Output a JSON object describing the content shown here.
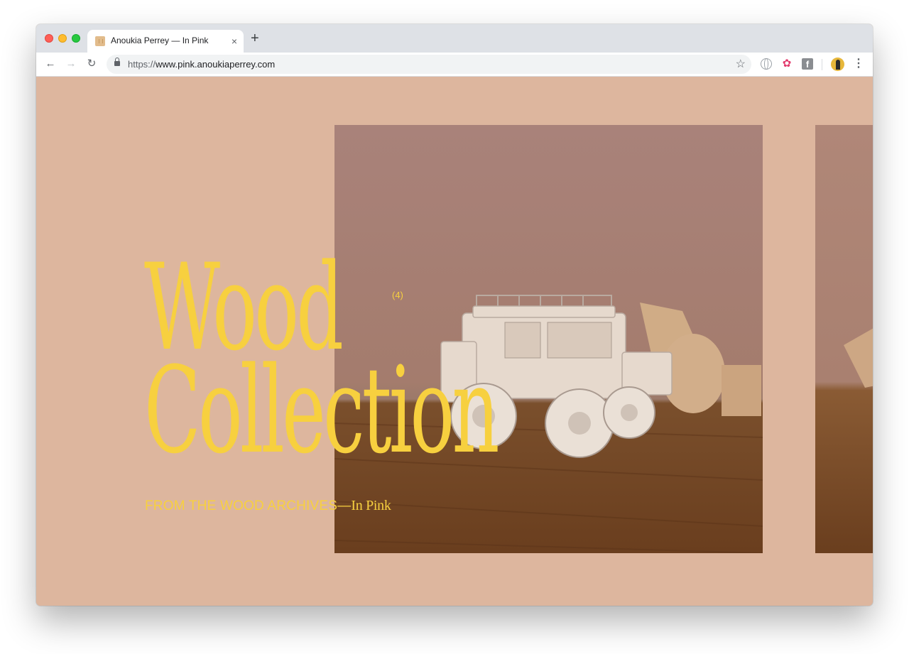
{
  "browser": {
    "tab_title": "Anoukia Perrey — In Pink",
    "tab_close": "×",
    "new_tab": "+",
    "url_scheme": "https://",
    "url_host": "www.pink.anoukiaperrey.com",
    "nav": {
      "back": "←",
      "forward": "→",
      "reload": "↻"
    },
    "bookmark_star": "☆",
    "menu": "⋮",
    "extensions": {
      "facebook": "f",
      "colorful": "✿"
    }
  },
  "page": {
    "heading_line1": "Wood",
    "heading_line2": "Collection",
    "count": "(4)",
    "subtitle_main": "FROM THE WOOD ARCHIVES—",
    "subtitle_sig": "In Pink"
  },
  "colors": {
    "background": "#ddb69e",
    "accent": "#f7d03f"
  }
}
